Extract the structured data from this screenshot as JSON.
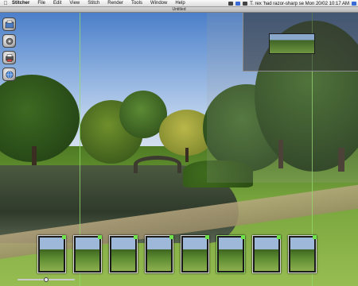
{
  "menubar": {
    "apple_icon": "apple-icon",
    "app_name": "Stitcher",
    "items": [
      "File",
      "Edit",
      "View",
      "Stitch",
      "Render",
      "Tools",
      "Window",
      "Help"
    ],
    "status_text": "T. rex 'had razor-sharp se Mon 20/02 10:17 AM",
    "colors": {
      "bar": "#e8e8e8"
    }
  },
  "window": {
    "title": "Untitled"
  },
  "toolbar": {
    "tools": [
      {
        "name": "import-images-icon"
      },
      {
        "name": "stitch-gear-icon"
      },
      {
        "name": "render-printer-icon"
      },
      {
        "name": "projection-globe-icon"
      }
    ]
  },
  "filmstrip": {
    "count": 8,
    "active_index": 5,
    "accent": "#93d86a"
  },
  "zoom": {
    "value": 0.5
  }
}
